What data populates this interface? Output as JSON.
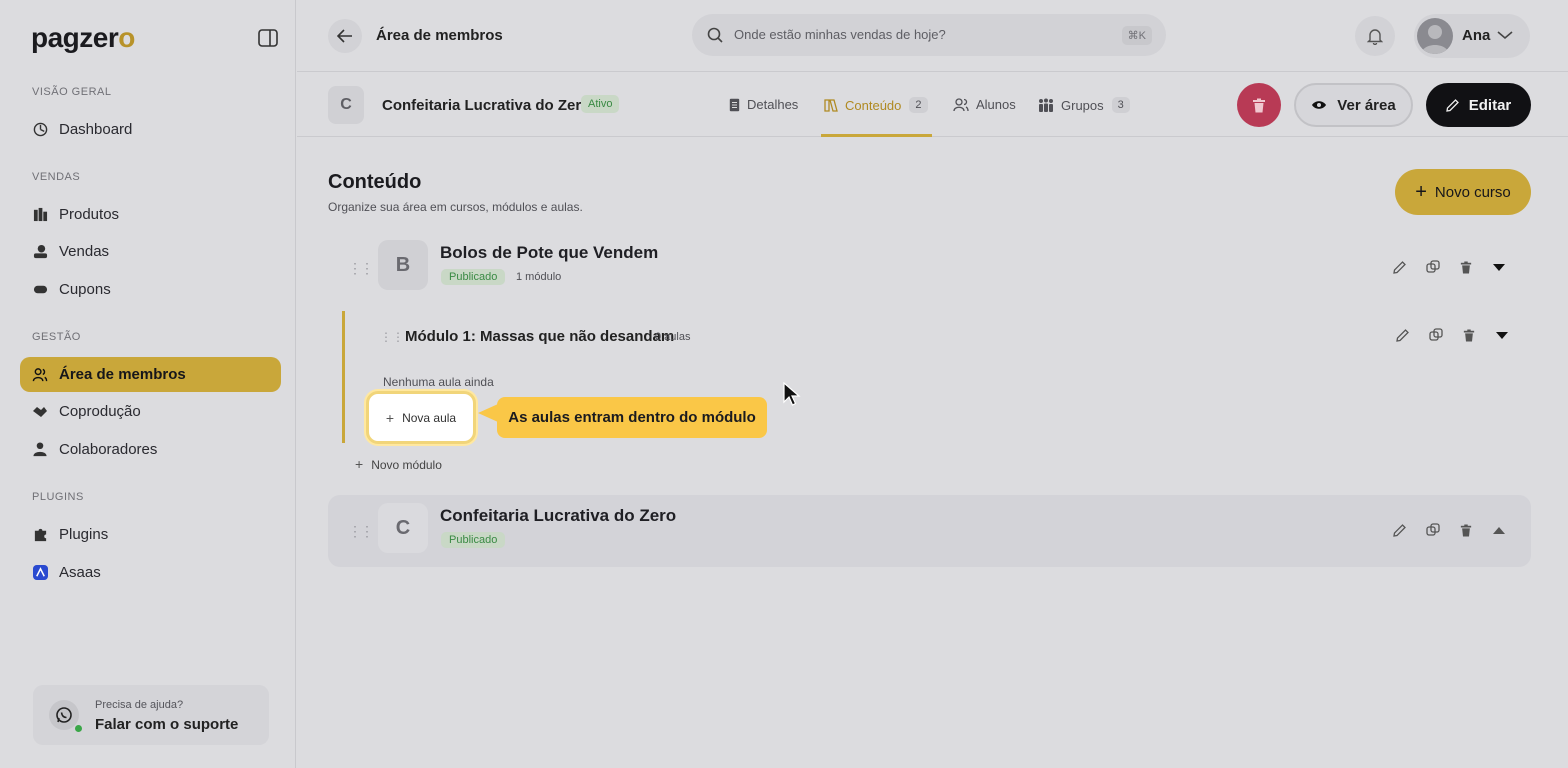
{
  "brand": {
    "logo_text": "pagzer",
    "logo_accent": "o",
    "accent_color": "#c9a73a"
  },
  "sidebar": {
    "sections": [
      "VISÃO GERAL",
      "VENDAS",
      "GESTÃO",
      "PLUGINS"
    ],
    "items": [
      {
        "label": "Dashboard",
        "icon": "dashboard-icon"
      },
      {
        "label": "Produtos",
        "icon": "products-icon"
      },
      {
        "label": "Vendas",
        "icon": "sales-icon"
      },
      {
        "label": "Cupons",
        "icon": "coupon-icon"
      },
      {
        "label": "Área de membros",
        "icon": "members-icon",
        "active": true
      },
      {
        "label": "Coprodução",
        "icon": "handshake-icon"
      },
      {
        "label": "Colaboradores",
        "icon": "user-icon"
      },
      {
        "label": "Plugins",
        "icon": "puzzle-icon"
      },
      {
        "label": "Asaas",
        "icon": "asaas-icon"
      }
    ],
    "help": {
      "line1": "Precisa de ajuda?",
      "line2": "Falar com o suporte"
    }
  },
  "topbar": {
    "breadcrumb": "Área de membros",
    "search_placeholder": "Onde estão minhas vendas de hoje?",
    "search_shortcut": "⌘K",
    "user_name": "Ana"
  },
  "course_bar": {
    "badge_letter": "C",
    "title": "Confeitaria Lucrativa do Zero",
    "status": "Ativo",
    "tabs": [
      {
        "label": "Detalhes",
        "count": ""
      },
      {
        "label": "Conteúdo",
        "count": "2",
        "active": true
      },
      {
        "label": "Alunos",
        "count": ""
      },
      {
        "label": "Grupos",
        "count": "3"
      }
    ],
    "view_label": "Ver área",
    "edit_label": "Editar"
  },
  "content": {
    "title": "Conteúdo",
    "subtitle": "Organize sua área em cursos, módulos e aulas.",
    "new_course_label": "Novo curso",
    "courses": [
      {
        "letter": "B",
        "title": "Bolos de Pote que Vendem",
        "status": "Publicado",
        "meta": "1 módulo",
        "expanded": true
      },
      {
        "letter": "C",
        "title": "Confeitaria Lucrativa do Zero",
        "status": "Publicado",
        "meta": "",
        "expanded": false
      }
    ],
    "module": {
      "title": "Módulo 1: Massas que não desandam",
      "lessons": "0 aulas",
      "empty": "Nenhuma aula ainda",
      "new_lesson_label": "Nova aula",
      "tooltip": "As aulas entram dentro do módulo"
    },
    "new_module_label": "Novo módulo"
  }
}
